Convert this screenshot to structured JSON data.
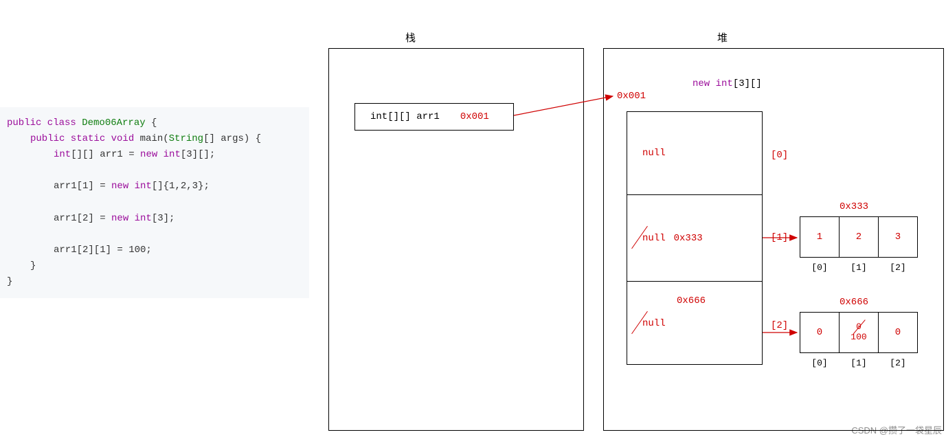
{
  "code": {
    "l1_pre": "public class ",
    "l1_cls": "Demo06Array",
    "l1_post": " {",
    "l2_pre": "public static void ",
    "l2_main": "main",
    "l2_paren_open": "(",
    "l2_type": "String",
    "l2_rest": "[] args) {",
    "l3_pre": "int",
    "l3_mid": "[][] arr1 = ",
    "l3_new": "new ",
    "l3_typ": "int",
    "l3_end": "[3][];",
    "l4_pre": "arr1[1] = ",
    "l4_new": "new ",
    "l4_typ": "int",
    "l4_end": "[]{1,2,3};",
    "l5_pre": "arr1[2] = ",
    "l5_new": "new ",
    "l5_typ": "int",
    "l5_end": "[3];",
    "l6": "arr1[2][1] = 100;",
    "l7": "}",
    "l8": "}"
  },
  "titles": {
    "stack": "栈",
    "heap": "堆"
  },
  "stackVar": {
    "name": "int[][] arr1",
    "addr": "0x001"
  },
  "heap": {
    "topAddr": "0x001",
    "newExpr_kw": "new ",
    "newExpr_typ": "int",
    "newExpr_rest": "[3][]",
    "rows": [
      {
        "null": "null",
        "addr": "",
        "idx": "[0]"
      },
      {
        "null": "null",
        "addr": "0x333",
        "idx": "[1]"
      },
      {
        "null": "null",
        "addr": "0x666",
        "idx": "[2]"
      }
    ],
    "sub1": {
      "addr": "0x333",
      "cells": [
        "1",
        "2",
        "3"
      ],
      "idx": [
        "[0]",
        "[1]",
        "[2]"
      ]
    },
    "sub2": {
      "addr": "0x666",
      "cells": [
        "0",
        "0",
        "0"
      ],
      "overwrite": "100",
      "idx": [
        "[0]",
        "[1]",
        "[2]"
      ]
    }
  },
  "watermark": "CSDN @攒了一袋星辰"
}
